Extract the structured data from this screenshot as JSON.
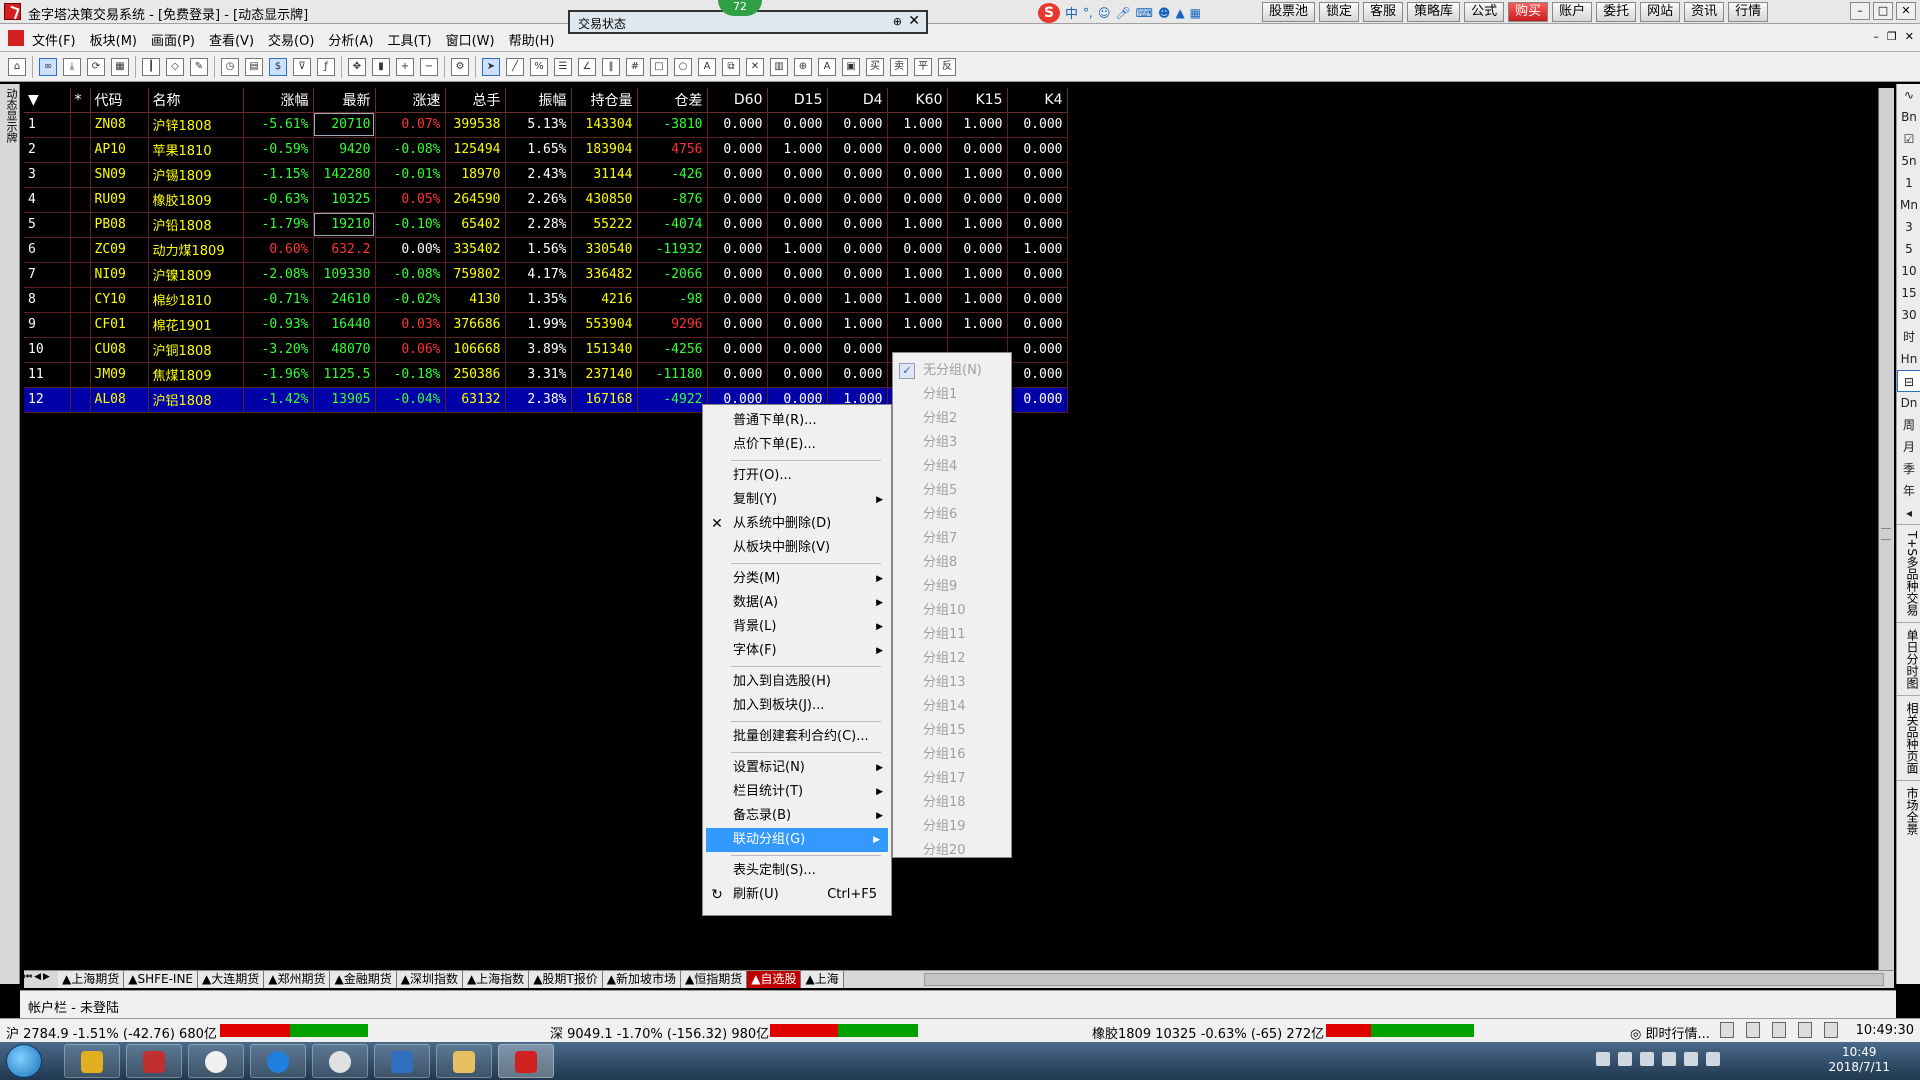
{
  "window": {
    "title": "金字塔决策交易系统 - [免费登录] - [动态显示牌]",
    "badge": "72"
  },
  "trade_status_panel": {
    "title": "交易状态",
    "pin": "⊕",
    "close": "✕"
  },
  "ime": {
    "logo": "S",
    "label": "中"
  },
  "top_buttons": [
    "股票池",
    "锁定",
    "客服",
    "策略库",
    "公式",
    "购买",
    "账户",
    "委托",
    "网站",
    "资讯",
    "行情"
  ],
  "menus": [
    "文件(F)",
    "板块(M)",
    "画面(P)",
    "查看(V)",
    "交易(O)",
    "分析(A)",
    "工具(T)",
    "窗口(W)",
    "帮助(H)"
  ],
  "left_strip_label": "动态显示牌",
  "columns": [
    "*",
    "代码",
    "名称",
    "涨幅",
    "最新",
    "涨速",
    "总手",
    "振幅",
    "持仓量",
    "仓差",
    "D60",
    "D15",
    "D4",
    "K60",
    "K15",
    "K4"
  ],
  "rows": [
    {
      "n": "1",
      "code": "ZN08",
      "name": "沪锌1808",
      "chg": "-5.61%",
      "last": "20710",
      "speed": "0.07%",
      "vol": "399538",
      "amp": "5.13%",
      "oi": "143304",
      "oidiff": "-3810",
      "d60": "0.000",
      "d15": "0.000",
      "d4": "0.000",
      "k60": "1.000",
      "k15": "1.000",
      "k4": "0.000"
    },
    {
      "n": "2",
      "code": "AP10",
      "name": "苹果1810",
      "chg": "-0.59%",
      "last": "9420",
      "speed": "-0.08%",
      "vol": "125494",
      "amp": "1.65%",
      "oi": "183904",
      "oidiff": "4756",
      "d60": "0.000",
      "d15": "1.000",
      "d4": "0.000",
      "k60": "0.000",
      "k15": "0.000",
      "k4": "0.000"
    },
    {
      "n": "3",
      "code": "SN09",
      "name": "沪锡1809",
      "chg": "-1.15%",
      "last": "142280",
      "speed": "-0.01%",
      "vol": "18970",
      "amp": "2.43%",
      "oi": "31144",
      "oidiff": "-426",
      "d60": "0.000",
      "d15": "0.000",
      "d4": "0.000",
      "k60": "0.000",
      "k15": "1.000",
      "k4": "0.000"
    },
    {
      "n": "4",
      "code": "RU09",
      "name": "橡胶1809",
      "chg": "-0.63%",
      "last": "10325",
      "speed": "0.05%",
      "vol": "264590",
      "amp": "2.26%",
      "oi": "430850",
      "oidiff": "-876",
      "d60": "0.000",
      "d15": "0.000",
      "d4": "0.000",
      "k60": "0.000",
      "k15": "0.000",
      "k4": "0.000"
    },
    {
      "n": "5",
      "code": "PB08",
      "name": "沪铅1808",
      "chg": "-1.79%",
      "last": "19210",
      "speed": "-0.10%",
      "vol": "65402",
      "amp": "2.28%",
      "oi": "55222",
      "oidiff": "-4074",
      "d60": "0.000",
      "d15": "0.000",
      "d4": "0.000",
      "k60": "1.000",
      "k15": "1.000",
      "k4": "0.000"
    },
    {
      "n": "6",
      "code": "ZC09",
      "name": "动力煤1809",
      "chg": "0.60%",
      "last": "632.2",
      "speed": "0.00%",
      "vol": "335402",
      "amp": "1.56%",
      "oi": "330540",
      "oidiff": "-11932",
      "d60": "0.000",
      "d15": "1.000",
      "d4": "0.000",
      "k60": "0.000",
      "k15": "0.000",
      "k4": "1.000"
    },
    {
      "n": "7",
      "code": "NI09",
      "name": "沪镍1809",
      "chg": "-2.08%",
      "last": "109330",
      "speed": "-0.08%",
      "vol": "759802",
      "amp": "4.17%",
      "oi": "336482",
      "oidiff": "-2066",
      "d60": "0.000",
      "d15": "0.000",
      "d4": "0.000",
      "k60": "1.000",
      "k15": "1.000",
      "k4": "0.000"
    },
    {
      "n": "8",
      "code": "CY10",
      "name": "棉纱1810",
      "chg": "-0.71%",
      "last": "24610",
      "speed": "-0.02%",
      "vol": "4130",
      "amp": "1.35%",
      "oi": "4216",
      "oidiff": "-98",
      "d60": "0.000",
      "d15": "0.000",
      "d4": "1.000",
      "k60": "1.000",
      "k15": "1.000",
      "k4": "0.000"
    },
    {
      "n": "9",
      "code": "CF01",
      "name": "棉花1901",
      "chg": "-0.93%",
      "last": "16440",
      "speed": "0.03%",
      "vol": "376686",
      "amp": "1.99%",
      "oi": "553904",
      "oidiff": "9296",
      "d60": "0.000",
      "d15": "0.000",
      "d4": "1.000",
      "k60": "1.000",
      "k15": "1.000",
      "k4": "0.000"
    },
    {
      "n": "10",
      "code": "CU08",
      "name": "沪铜1808",
      "chg": "-3.20%",
      "last": "48070",
      "speed": "0.06%",
      "vol": "106668",
      "amp": "3.89%",
      "oi": "151340",
      "oidiff": "-4256",
      "d60": "0.000",
      "d15": "0.000",
      "d4": "0.000",
      "k60": "",
      "k15": "",
      "k4": "0.000"
    },
    {
      "n": "11",
      "code": "JM09",
      "name": "焦煤1809",
      "chg": "-1.96%",
      "last": "1125.5",
      "speed": "-0.18%",
      "vol": "250386",
      "amp": "3.31%",
      "oi": "237140",
      "oidiff": "-11180",
      "d60": "0.000",
      "d15": "0.000",
      "d4": "0.000",
      "k60": "",
      "k15": "",
      "k4": "0.000"
    },
    {
      "n": "12",
      "code": "AL08",
      "name": "沪铝1808",
      "chg": "-1.42%",
      "last": "13905",
      "speed": "-0.04%",
      "vol": "63132",
      "amp": "2.38%",
      "oi": "167168",
      "oidiff": "-4922",
      "d60": "0.000",
      "d15": "0.000",
      "d4": "1.000",
      "k60": "",
      "k15": "",
      "k4": "0.000"
    }
  ],
  "context_menu": [
    {
      "label": "普通下单(R)..."
    },
    {
      "label": "点价下单(E)..."
    },
    {
      "sep": true
    },
    {
      "label": "打开(O)..."
    },
    {
      "label": "复制(Y)",
      "sub": true
    },
    {
      "label": "从系统中删除(D)",
      "icon": "✕"
    },
    {
      "label": "从板块中删除(V)"
    },
    {
      "sep": true
    },
    {
      "label": "分类(M)",
      "sub": true
    },
    {
      "label": "数据(A)",
      "sub": true
    },
    {
      "label": "背景(L)",
      "sub": true
    },
    {
      "label": "字体(F)",
      "sub": true
    },
    {
      "sep": true
    },
    {
      "label": "加入到自选股(H)"
    },
    {
      "label": "加入到板块(J)..."
    },
    {
      "sep": true
    },
    {
      "label": "批量创建套利合约(C)..."
    },
    {
      "sep": true
    },
    {
      "label": "设置标记(N)",
      "sub": true
    },
    {
      "label": "栏目统计(T)",
      "sub": true
    },
    {
      "label": "备忘录(B)",
      "sub": true
    },
    {
      "label": "联动分组(G)",
      "sub": true,
      "highlight": true
    },
    {
      "sep": true
    },
    {
      "label": "表头定制(S)..."
    },
    {
      "label": "刷新(U)",
      "shortcut": "Ctrl+F5",
      "icon": "↻"
    }
  ],
  "submenu": [
    "无分组(N)",
    "分组1",
    "分组2",
    "分组3",
    "分组4",
    "分组5",
    "分组6",
    "分组7",
    "分组8",
    "分组9",
    "分组10",
    "分组11",
    "分组12",
    "分组13",
    "分组14",
    "分组15",
    "分组16",
    "分组17",
    "分组18",
    "分组19",
    "分组20"
  ],
  "submenu_checked": "无分组(N)",
  "tabs": [
    "▲上海期货",
    "▲SHFE-INE",
    "▲大连期货",
    "▲郑州期货",
    "▲金融期货",
    "▲深圳指数",
    "▲上海指数",
    "▲股期T报价",
    "▲新加坡市场",
    "▲恒指期货",
    "▲自选股",
    "▲上海"
  ],
  "active_tab": "▲自选股",
  "account_bar": "帐户栏 - 未登陆",
  "status": {
    "sh": "沪 2784.9 -1.51% (-42.76) 680亿",
    "sz": "深 9049.1 -1.70% (-156.32) 980亿",
    "ru": "橡胶1809 10325 -0.63% (-65) 272亿",
    "realtime": "◎ 即时行情...",
    "time": "10:49:30"
  },
  "taskbar_clock": {
    "time": "10:49",
    "date": "2018/7/11"
  },
  "right_strip": [
    "∿",
    "Bn",
    "☑",
    "5n",
    "1",
    "Mn",
    "3",
    "5",
    "10",
    "15",
    "30",
    "时",
    "Hn",
    "⊟",
    "Dn",
    "周",
    "月",
    "季",
    "年",
    "◂"
  ],
  "right_vertical": [
    "T+S多品种交易",
    "单日分时图",
    "相关品种页面",
    "市场全景"
  ],
  "colors": {
    "up": "#ff3333",
    "down": "#33ff33",
    "name": "#ffff00",
    "selected_row": "#0000a8",
    "menu_highlight": "#3399ff"
  }
}
